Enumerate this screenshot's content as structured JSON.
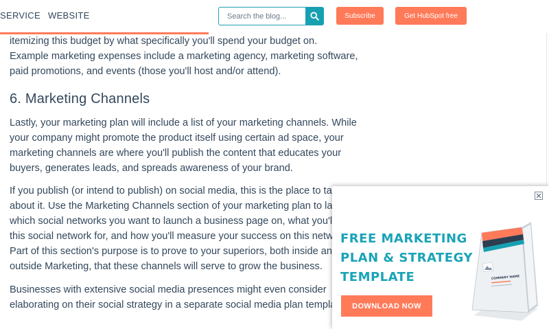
{
  "nav": {
    "service_label": "SERVICE",
    "website_label": "WEBSITE"
  },
  "search": {
    "placeholder": "Search the blog...",
    "value": ""
  },
  "header_buttons": {
    "subscribe_label": "Subscribe",
    "get_free_label": "Get HubSpot free"
  },
  "reading_progress": {
    "percent": 38
  },
  "article": {
    "intro_paragraph": "itemizing this budget by what specifically you'll spend your budget on. Example marketing expenses include a marketing agency, marketing software, paid promotions, and events (those you'll host and/or attend).",
    "section_heading": "6. Marketing Channels",
    "paragraph_channels": "Lastly, your marketing plan will include a list of your marketing channels. While your company might promote the product itself using certain ad space, your marketing channels are where you'll publish the content that educates your buyers, generates leads, and spreads awareness of your brand.",
    "paragraph_social": "If you publish (or intend to publish) on social media, this is the place to talk about it. Use the Marketing Channels section of your marketing plan to lay out which social networks you want to launch a business page on, what you'll use this social network for, and how you'll measure your success on this network. Part of this section's purpose is to prove to your superiors, both inside and outside Marketing, that these channels will serve to grow the business.",
    "paragraph_extensive": "Businesses with extensive social media presences might even consider elaborating on their social strategy in a separate social media plan template."
  },
  "popup": {
    "title_line_1": "FREE MARKETING",
    "title_line_2": "PLAN & STRATEGY",
    "title_line_3": "TEMPLATE",
    "cta_label": "DOWNLOAD NOW",
    "close_icon": "close-icon",
    "book_cover_text": "COMPANY NAME"
  },
  "colors": {
    "brand_orange": "#ff7a59",
    "brand_teal": "#17a0b2",
    "text": "#33475b"
  }
}
